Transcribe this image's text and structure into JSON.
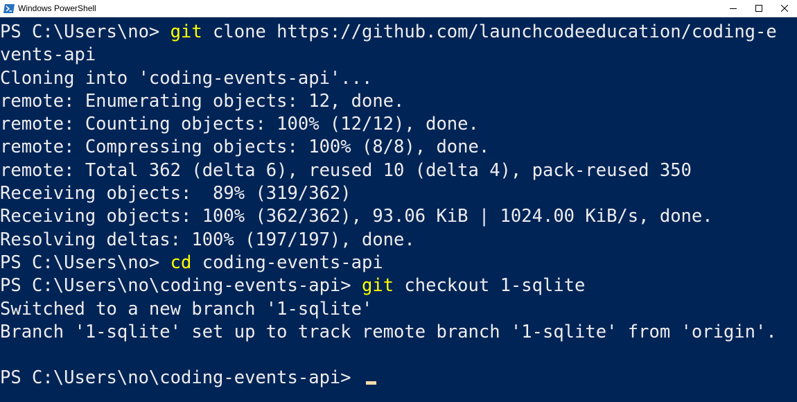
{
  "window": {
    "title": "Windows PowerShell"
  },
  "colors": {
    "background": "#012456",
    "text": "#eeedf0",
    "command": "#ffff00",
    "cursor": "#fedba9"
  },
  "icons": {
    "app": "powershell-icon",
    "minimize": "minimize-icon",
    "maximize": "maximize-icon",
    "close": "close-icon"
  },
  "terminal": {
    "lines": [
      {
        "prompt": "PS C:\\Users\\no> ",
        "cmd": "git",
        "args": " clone https://github.com/launchcodeeducation/coding-e"
      },
      {
        "text": "vents-api"
      },
      {
        "text": "Cloning into 'coding-events-api'..."
      },
      {
        "text": "remote: Enumerating objects: 12, done."
      },
      {
        "text": "remote: Counting objects: 100% (12/12), done."
      },
      {
        "text": "remote: Compressing objects: 100% (8/8), done."
      },
      {
        "text": "remote: Total 362 (delta 6), reused 10 (delta 4), pack-reused 350"
      },
      {
        "text": "Receiving objects:  89% (319/362)"
      },
      {
        "text": "Receiving objects: 100% (362/362), 93.06 KiB | 1024.00 KiB/s, done."
      },
      {
        "text": "Resolving deltas: 100% (197/197), done."
      },
      {
        "prompt": "PS C:\\Users\\no> ",
        "cmd": "cd",
        "args": " coding-events-api"
      },
      {
        "prompt": "PS C:\\Users\\no\\coding-events-api> ",
        "cmd": "git",
        "args": " checkout 1-sqlite"
      },
      {
        "text": "Switched to a new branch '1-sqlite'"
      },
      {
        "text": "Branch '1-sqlite' set up to track remote branch '1-sqlite' from 'origin'."
      },
      {
        "text": ""
      },
      {
        "prompt": "PS C:\\Users\\no\\coding-events-api> ",
        "cursor": true
      }
    ]
  }
}
